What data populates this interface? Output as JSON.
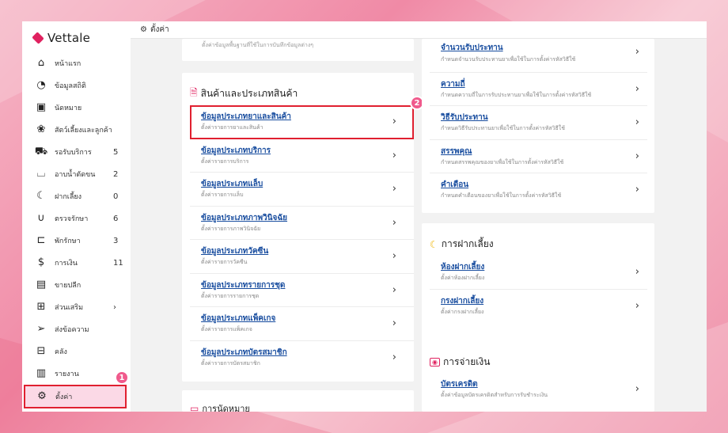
{
  "app": {
    "name": "Vettale"
  },
  "topbar": {
    "icon": "gear-icon",
    "title": "ตั้งค่า"
  },
  "sidebar": {
    "items": [
      {
        "label": "หน้าแรก",
        "icon": "home-icon",
        "count": ""
      },
      {
        "label": "ข้อมูลสถิติ",
        "icon": "stats-icon",
        "count": ""
      },
      {
        "label": "นัดหมาย",
        "icon": "calendar-icon",
        "count": ""
      },
      {
        "label": "สัตว์เลี้ยงและลูกค้า",
        "icon": "paw-icon",
        "count": ""
      },
      {
        "label": "รอรับบริการ",
        "icon": "sofa-icon",
        "count": "5"
      },
      {
        "label": "อาบน้ำตัดขน",
        "icon": "bath-icon",
        "count": "2"
      },
      {
        "label": "ฝากเลี้ยง",
        "icon": "moon-icon",
        "count": "0"
      },
      {
        "label": "ตรวจรักษา",
        "icon": "stethoscope-icon",
        "count": "6"
      },
      {
        "label": "พักรักษา",
        "icon": "bed-icon",
        "count": "3"
      },
      {
        "label": "การเงิน",
        "icon": "money-icon",
        "count": "11"
      },
      {
        "label": "ขายปลีก",
        "icon": "register-icon",
        "count": ""
      },
      {
        "label": "ส่วนเสริม",
        "icon": "plus-icon",
        "count": "›"
      },
      {
        "label": "ส่งข้อความ",
        "icon": "send-icon",
        "count": ""
      },
      {
        "label": "คลัง",
        "icon": "archive-icon",
        "count": ""
      },
      {
        "label": "รายงาน",
        "icon": "chart-icon",
        "count": ""
      },
      {
        "label": "ตั้งค่า",
        "icon": "gear-icon",
        "count": ""
      }
    ]
  },
  "badges": {
    "one": "1",
    "two": "2"
  },
  "products_card": {
    "top_partial": "ตั้งค่าข้อมูลพื้นฐานที่ใช้ในการบันทึกข้อมูลต่างๆ",
    "title": "สินค้าและประเภทสินค้า",
    "items": [
      {
        "title": "ข้อมูลประเภทยาและสินค้า",
        "desc": "ตั้งค่ารายการยาและสินค้า"
      },
      {
        "title": "ข้อมูลประเภทบริการ",
        "desc": "ตั้งค่ารายการบริการ"
      },
      {
        "title": "ข้อมูลประเภทแล็บ",
        "desc": "ตั้งค่ารายการแล็บ"
      },
      {
        "title": "ข้อมูลประเภทภาพวินิจฉัย",
        "desc": "ตั้งค่ารายการภาพวินิจฉัย"
      },
      {
        "title": "ข้อมูลประเภทวัคซีน",
        "desc": "ตั้งค่ารายการวัคซีน"
      },
      {
        "title": "ข้อมูลประเภทรายการชุด",
        "desc": "ตั้งค่ารายการรายการชุด"
      },
      {
        "title": "ข้อมูลประเภทแพ็คเกจ",
        "desc": "ตั้งค่ารายการแพ็คเกจ"
      },
      {
        "title": "ข้อมูลประเภทบัตรสมาชิก",
        "desc": "ตั้งค่ารายการบัตรสมาชิก"
      }
    ],
    "bottom_partial": "การนัดหมาย"
  },
  "drug_card": {
    "items": [
      {
        "title": "จำนวนรับประทาน",
        "desc": "กำหนดจำนวนรับประทานยาเพื่อใช้ในการตั้งค่ารหัสวิธีใช้"
      },
      {
        "title": "ความถี่",
        "desc": "กำหนดความถี่ในการรับประทานยาเพื่อใช้ในการตั้งค่ารหัสวิธีใช้"
      },
      {
        "title": "วิธีรับประทาน",
        "desc": "กำหนดวิธีรับประทานยาเพื่อใช้ในการตั้งค่ารหัสวิธีใช้"
      },
      {
        "title": "สรรพคุณ",
        "desc": "กำหนดสรรพคุณของยาเพื่อใช้ในการตั้งค่ารหัสวิธีใช้"
      },
      {
        "title": "คำเตือน",
        "desc": "กำหนดคำเตือนของยาเพื่อใช้ในการตั้งค่ารหัสวิธีใช้"
      }
    ]
  },
  "boarding_card": {
    "title": "การฝากเลี้ยง",
    "items": [
      {
        "title": "ห้องฝากเลี้ยง",
        "desc": "ตั้งค่าห้องฝากเลี้ยง"
      },
      {
        "title": "กรงฝากเลี้ยง",
        "desc": "ตั้งค่ากรงฝากเลี้ยง"
      }
    ]
  },
  "payment_card": {
    "title": "การจ่ายเงิน",
    "items": [
      {
        "title": "บัตรเครดิต",
        "desc": "ตั้งค่าข้อมูลบัตรเครดิตสำหรับการรับชำระเงิน"
      }
    ]
  },
  "colors": {
    "accent": "#e0215f",
    "link": "#1b4fa0",
    "highlight": "#e02030",
    "badge": "#f05a8c",
    "active_bg": "#fbd9e6"
  }
}
